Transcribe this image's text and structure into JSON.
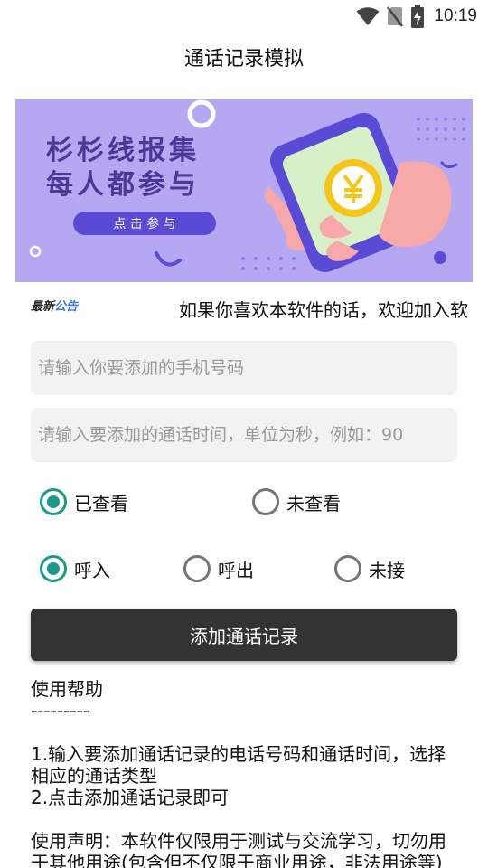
{
  "status_bar": {
    "time": "10:19",
    "icons": [
      "wifi-icon",
      "no-sim-icon",
      "battery-charging-icon"
    ]
  },
  "app": {
    "title": "通话记录模拟"
  },
  "banner": {
    "line1": "杉杉线报集",
    "line2": "每人都参与",
    "button_label": "点 击 参 与",
    "coin_symbol": "¥",
    "colors": {
      "background": "#b6a7f2",
      "text": "#4a3a96",
      "phone": "#5a4bd6",
      "coin": "#f5c518",
      "hand": "#f7a8a8"
    }
  },
  "notice": {
    "logo_part1": "最新",
    "logo_part2": "公告",
    "text": "如果你喜欢本软件的话，欢迎加入软"
  },
  "form": {
    "phone_placeholder": "请输入你要添加的手机号码",
    "phone_value": "",
    "duration_placeholder": "请输入要添加的通话时间，单位为秒，例如：90",
    "duration_value": "",
    "view_status": {
      "options": [
        {
          "label": "已查看",
          "checked": true
        },
        {
          "label": "未查看",
          "checked": false
        }
      ]
    },
    "call_type": {
      "options": [
        {
          "label": "呼入",
          "checked": true
        },
        {
          "label": "呼出",
          "checked": false
        },
        {
          "label": "未接",
          "checked": false
        }
      ]
    },
    "submit_label": "添加通话记录"
  },
  "help": {
    "title": "使用帮助",
    "divider": "---------",
    "step1": "1.输入要添加通话记录的电话号码和通话时间，选择相应的通话类型",
    "step2": "2.点击添加通话记录即可",
    "disclaimer": "使用声明：本软件仅限用于测试与交流学习，切勿用于其他用途(包含但不仅限于商业用途，非法用途等)"
  },
  "colors": {
    "accent": "#1a9a8a",
    "button": "#333333",
    "field_bg": "#f2f2f2"
  }
}
